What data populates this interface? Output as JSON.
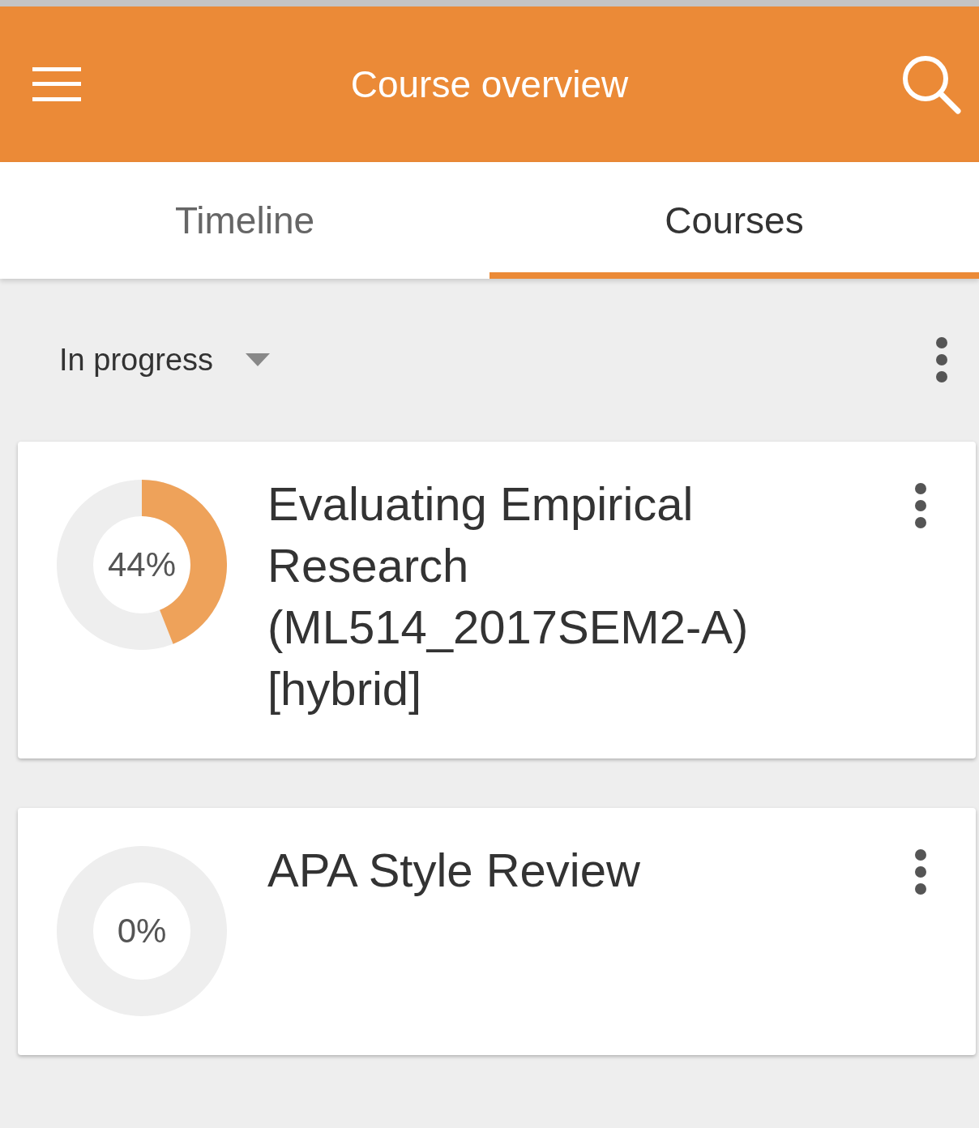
{
  "header": {
    "title": "Course overview"
  },
  "tabs": [
    {
      "label": "Timeline",
      "selected": false
    },
    {
      "label": "Courses",
      "selected": true
    }
  ],
  "filter": {
    "label": "In progress"
  },
  "courses": [
    {
      "title": "Evaluating Empirical Research (ML514_2017SEM2-A) [hybrid]",
      "progress": "44%"
    },
    {
      "title": "APA Style Review",
      "progress": "0%"
    }
  ]
}
